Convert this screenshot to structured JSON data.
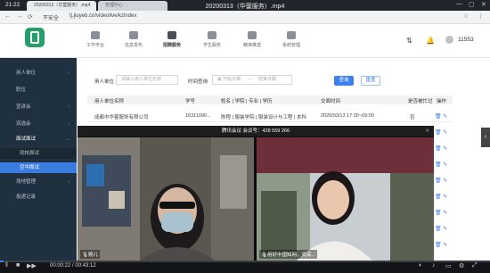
{
  "player": {
    "clock": "21:22",
    "tabs": [
      "20200313（华蓥服务）.mp4",
      "管理中心"
    ],
    "title": "20200313（华蓥服务）.mp4",
    "win_controls": [
      "—",
      "▢",
      "✕"
    ],
    "time_current": "00:00:22",
    "time_total": "00:43:12",
    "progress": 0.008,
    "left_controls": [
      "‖",
      "■",
      "▶▶"
    ],
    "right_controls": [
      "◐",
      "♪",
      "▭",
      "⚙",
      "⤢"
    ]
  },
  "address": {
    "security": "不安全",
    "url": "tj.jiuyeb.cn/videolive/kzlndex",
    "nav": [
      "←",
      "→",
      "⟳"
    ],
    "right": [
      "☆",
      "⋮"
    ]
  },
  "topnav": {
    "items": [
      {
        "label": "工作平台",
        "icon": "desktop-icon"
      },
      {
        "label": "信息发布",
        "icon": "cloud-upload-icon"
      },
      {
        "label": "招聘服务",
        "icon": "briefcase-icon"
      },
      {
        "label": "学生服务",
        "icon": "user-icon"
      },
      {
        "label": "精准推送",
        "icon": "target-icon"
      },
      {
        "label": "系统管理",
        "icon": "gear-icon"
      }
    ],
    "active_index": 2,
    "user_id": "11553"
  },
  "sidebar": {
    "items": [
      {
        "label": "用人单位",
        "type": "item"
      },
      {
        "label": "职位",
        "type": "item"
      },
      {
        "label": "宣讲会",
        "type": "item"
      },
      {
        "label": "双选会",
        "type": "item"
      },
      {
        "label": "面试面试",
        "type": "open"
      },
      {
        "label": "就校面试",
        "type": "sub"
      },
      {
        "label": "空中面试",
        "type": "active"
      },
      {
        "label": "场地管理",
        "type": "item"
      },
      {
        "label": "投递记录",
        "type": "item"
      }
    ]
  },
  "filters": {
    "company_label": "用人单位",
    "company_placeholder": "请输入用人单位名称",
    "time_label": "时间查询",
    "start_placeholder": "开始日期",
    "separator": "—",
    "end_placeholder": "结束日期",
    "search_button": "查询",
    "reset_button": "重置"
  },
  "table": {
    "headers": [
      "用人单位名称",
      "学号",
      "姓名 | 学院 | 专业 | 学历",
      "交面时间",
      "是否被忙过",
      "操作"
    ],
    "rows": [
      [
        "成都市华蓥服饰有限公司",
        "16311090...",
        "陈程 | 服装学院 | 服装设计与工程 | 本科",
        "2020/03/13 17:30~09:00",
        "否"
      ]
    ]
  },
  "meeting": {
    "title": "腾讯会议 会议号：428 559 266",
    "left_name": "婉儿",
    "right_name": "用好中国知网，交高..."
  }
}
